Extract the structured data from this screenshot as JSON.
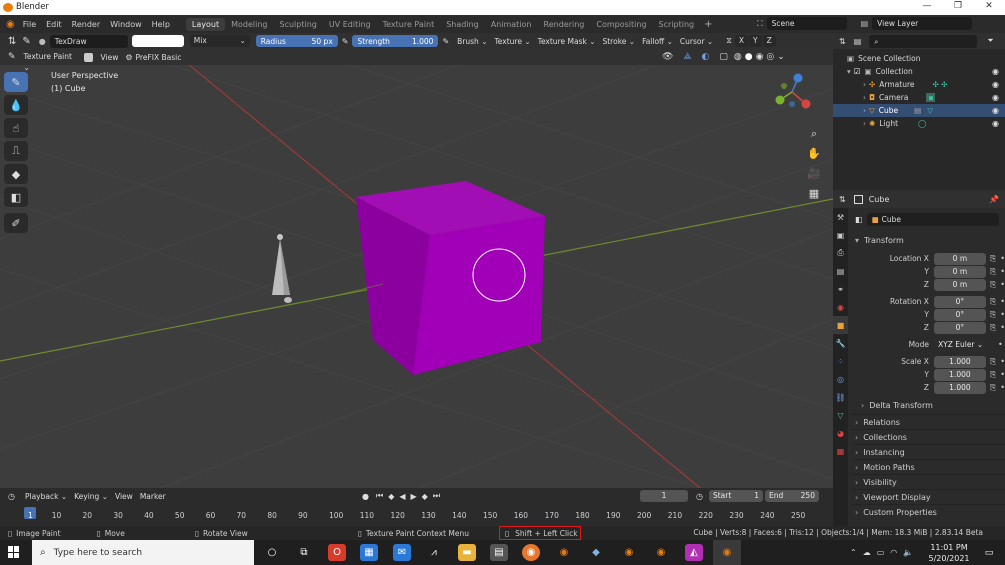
{
  "window": {
    "title": "Blender",
    "controls": [
      "—",
      "❐",
      "✕"
    ]
  },
  "menu": [
    "File",
    "Edit",
    "Render",
    "Window",
    "Help"
  ],
  "workspaces": [
    "Layout",
    "Modeling",
    "Sculpting",
    "UV Editing",
    "Texture Paint",
    "Shading",
    "Animation",
    "Rendering",
    "Compositing",
    "Scripting"
  ],
  "active_workspace": "Layout",
  "scene": "Scene",
  "view_layer": "View Layer",
  "tool_header": {
    "brush": "TexDraw",
    "blend": "Mix",
    "radius_label": "Radius",
    "radius_value": "50 px",
    "strength_label": "Strength",
    "strength_value": "1.000",
    "menus": [
      "Brush",
      "Texture",
      "Texture Mask",
      "Stroke",
      "Falloff",
      "Cursor"
    ],
    "axes": [
      "X",
      "Y",
      "Z"
    ]
  },
  "view_header": {
    "mode": "Texture Paint",
    "view": "View",
    "addon": "PreFIX Basic"
  },
  "viewport": {
    "perspective": "User Perspective",
    "object": "(1) Cube",
    "cube_color": "#a100b8"
  },
  "outliner": {
    "root": "Scene Collection",
    "collection": "Collection",
    "items": [
      "Armature",
      "Camera",
      "Cube",
      "Light"
    ],
    "selected": "Cube"
  },
  "properties": {
    "object_name": "Cube",
    "data_name": "Cube",
    "transform_title": "Transform",
    "location_label": "Location X",
    "location": [
      "0 m",
      "0 m",
      "0 m"
    ],
    "rotation_label": "Rotation X",
    "rotation": [
      "0°",
      "0°",
      "0°"
    ],
    "mode_label": "Mode",
    "mode_value": "XYZ Euler",
    "scale_label": "Scale X",
    "scale": [
      "1.000",
      "1.000",
      "1.000"
    ],
    "axis_y": "Y",
    "axis_z": "Z",
    "delta": "Delta Transform",
    "sections": [
      "Relations",
      "Collections",
      "Instancing",
      "Motion Paths",
      "Visibility",
      "Viewport Display",
      "Custom Properties"
    ]
  },
  "timeline": {
    "menus": [
      "Playback",
      "Keying",
      "View",
      "Marker"
    ],
    "current_frame": "1",
    "start_label": "Start",
    "start": "1",
    "end_label": "End",
    "end": "250",
    "ticks": [
      "1",
      "10",
      "20",
      "30",
      "40",
      "50",
      "60",
      "70",
      "80",
      "90",
      "100",
      "110",
      "120",
      "130",
      "140",
      "150",
      "160",
      "170",
      "180",
      "190",
      "200",
      "210",
      "220",
      "230",
      "240",
      "250"
    ]
  },
  "statusbar": {
    "hint1": "Image Paint",
    "hint2": "Move",
    "hint3": "Rotate View",
    "hint4": "Texture Paint Context Menu",
    "highlight": "Shift + Left Click",
    "stats": "Cube | Verts:8 | Faces:6 | Tris:12 | Objects:1/4 | Mem: 18.3 MiB | 2.83.14 Beta"
  },
  "taskbar": {
    "search_placeholder": "Type here to search",
    "time": "11:01 PM",
    "date": "5/20/2021"
  }
}
